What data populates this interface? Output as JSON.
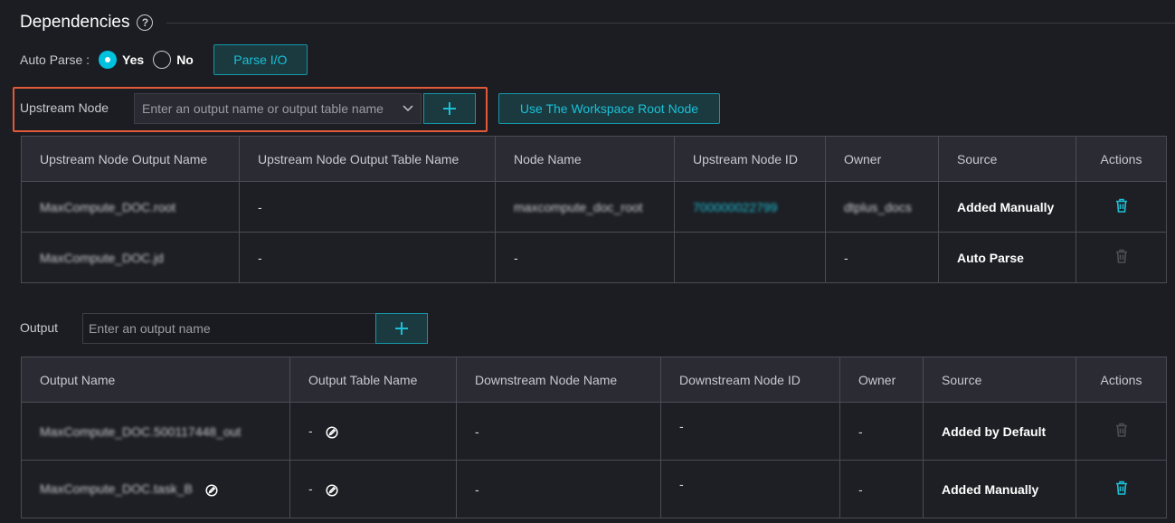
{
  "section": {
    "title": "Dependencies",
    "help_icon": "?"
  },
  "auto_parse": {
    "label": "Auto Parse :",
    "yes": "Yes",
    "no": "No",
    "selected": "Yes",
    "parse_button": "Parse I/O"
  },
  "upstream": {
    "label": "Upstream Node",
    "placeholder": "Enter an output name or output table name",
    "add_button": "+",
    "root_button": "Use The Workspace Root Node",
    "columns": [
      "Upstream Node Output Name",
      "Upstream Node Output Table Name",
      "Node Name",
      "Upstream Node ID",
      "Owner",
      "Source",
      "Actions"
    ],
    "rows": [
      {
        "output_name": "MaxCompute_DOC.root",
        "table_name": "-",
        "node_name": "maxcompute_doc_root",
        "node_id": "700000022799",
        "owner": "dtplus_docs",
        "source": "Added Manually",
        "delete_enabled": true
      },
      {
        "output_name": "MaxCompute_DOC.jd",
        "table_name": "-",
        "node_name": "-",
        "node_id": "",
        "owner": "-",
        "source": "Auto Parse",
        "delete_enabled": false
      }
    ]
  },
  "output": {
    "label": "Output",
    "placeholder": "Enter an output name",
    "add_button": "+",
    "columns": [
      "Output Name",
      "Output Table Name",
      "Downstream Node Name",
      "Downstream Node ID",
      "Owner",
      "Source",
      "Actions"
    ],
    "rows": [
      {
        "output_name": "MaxCompute_DOC.500117448_out",
        "table_name": "-",
        "downstream_name": "-",
        "downstream_id": "-",
        "owner": "-",
        "source": "Added by Default",
        "delete_enabled": false
      },
      {
        "output_name": "MaxCompute_DOC.task_B",
        "table_name": "-",
        "downstream_name": "-",
        "downstream_id": "-",
        "owner": "-",
        "source": "Added Manually",
        "delete_enabled": true
      }
    ]
  },
  "colors": {
    "accent": "#1bc0d6",
    "highlight_border": "#e05a3a",
    "background": "#1c1d22"
  }
}
